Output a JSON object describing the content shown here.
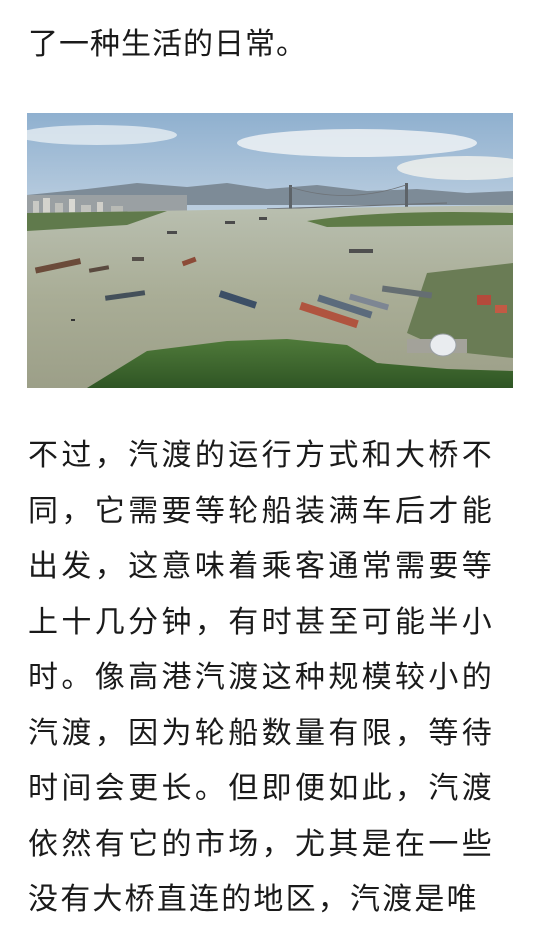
{
  "article": {
    "intro_tail": "了一种生活的日常。",
    "photo_icon": "river-aerial-photo",
    "body_text": "不过，汽渡的运行方式和大桥不同，它需要等轮船装满车后才能出发，这意味着乘客通常需要等上十几分钟，有时甚至可能半小时。像高港汽渡这种规模较小的汽渡，因为轮船数量有限，等待时间会更长。但即便如此，汽渡依然有它的市场，尤其是在一些没有大桥直连的地区，汽渡是唯"
  }
}
